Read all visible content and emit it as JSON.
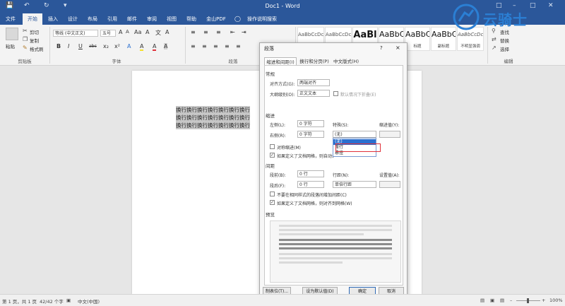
{
  "window": {
    "title": "Doc1 - Word"
  },
  "ribbon_tabs": [
    "文件",
    "开始",
    "插入",
    "设计",
    "布局",
    "引用",
    "邮件",
    "审阅",
    "视图",
    "帮助",
    "金山PDF"
  ],
  "tell_me": "操作说明搜索",
  "clipboard": {
    "paste": "粘贴",
    "cut": "剪切",
    "copy": "复制",
    "format_painter": "格式刷",
    "group": "剪贴板"
  },
  "font": {
    "name": "等线 (中文正文)",
    "size": "五号",
    "group": "字体",
    "buttons": [
      "B",
      "I",
      "U",
      "abc",
      "x₂",
      "x²",
      "A",
      "A",
      "A",
      "Aa",
      "A"
    ]
  },
  "paragraph": {
    "group": "段落"
  },
  "styles": [
    {
      "sample": "AaBbCcDc",
      "name": ""
    },
    {
      "sample": "AaBbCcDc",
      "name": ""
    },
    {
      "sample": "AaBl",
      "name": ""
    },
    {
      "sample": "AaBbC",
      "name": ""
    },
    {
      "sample": "AaBbC",
      "name": "标题"
    },
    {
      "sample": "AaBbC",
      "name": "副标题"
    },
    {
      "sample": "AaBbCcDc",
      "name": "不明显强调"
    }
  ],
  "editing": {
    "find": "查找",
    "replace": "替换",
    "select": "选择",
    "group": "编辑"
  },
  "logo_text": "云骑士",
  "document": {
    "lines": [
      "换行换行换行换行换行换行换行",
      "换行换行换行换行换行换行换行",
      "换行换行换行换行换行换行换行"
    ]
  },
  "dialog": {
    "title": "段落",
    "help": "?",
    "close": "×",
    "tabs": [
      "缩进和间距(I)",
      "换行和分页(P)",
      "中文版式(H)"
    ],
    "general": {
      "heading": "常规",
      "alignment_label": "对齐方式(G):",
      "alignment_value": "两端对齐",
      "outline_label": "大纲级别(O):",
      "outline_value": "正文文本",
      "collapse_label": "默认情况下折叠(E)"
    },
    "indent": {
      "heading": "缩进",
      "left_label": "左侧(L):",
      "left_value": "0 字符",
      "right_label": "右侧(R):",
      "right_value": "0 字符",
      "special_label": "特殊(S):",
      "special_value": "(无)",
      "indent_value_label": "缩进值(Y):",
      "mirror_label": "对称缩进(M)",
      "grid_label": "如果定义了文档网格，则自动调整右缩进(D)"
    },
    "special_options": [
      "(无)",
      "首行",
      "悬挂"
    ],
    "spacing": {
      "heading": "间距",
      "before_label": "段前(B):",
      "before_value": "0 行",
      "after_label": "段后(F):",
      "after_value": "0 行",
      "line_label": "行距(N):",
      "line_value": "单倍行距",
      "setting_label": "设置值(A):",
      "no_space_label": "不要在相同样式的段落间增加间距(C)",
      "snap_label": "如果定义了文档网格，则对齐到网格(W)"
    },
    "preview": {
      "heading": "预览"
    },
    "buttons": {
      "tabs": "制表位(T)...",
      "default": "设为默认值(D)",
      "ok": "确定",
      "cancel": "取消"
    }
  },
  "status": {
    "page": "第 1 页，共 1 页",
    "words": "42/42 个字",
    "language": "中文(中国)",
    "zoom": "100%"
  },
  "colors": {
    "accent": "#2b579a",
    "selection": "#2b6fcf",
    "highlight_box": "#e0303a",
    "logo": "#2b7fd4"
  }
}
